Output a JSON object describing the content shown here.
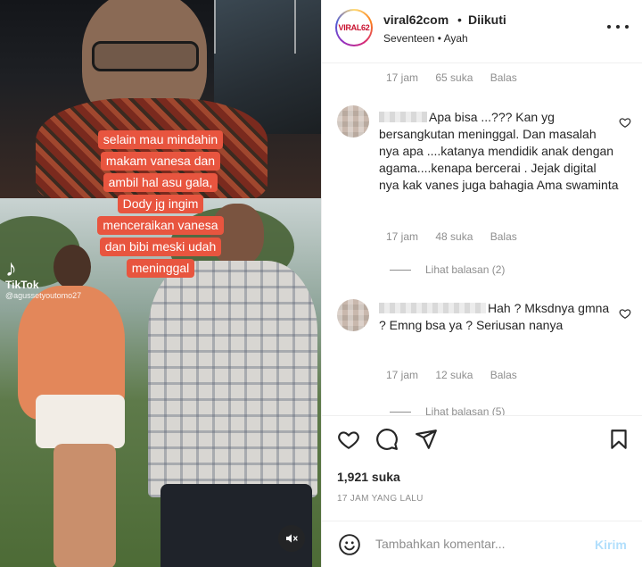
{
  "media": {
    "caption_lines": [
      "selain mau mindahin",
      "makam vanesa dan",
      "ambil hal asu gala,",
      "Dody jg ingim",
      "menceraikan vanesa",
      "dan bibi meski udah",
      "meninggal"
    ],
    "tiktok_name": "TikTok",
    "tiktok_handle": "@agussetyoutomo27",
    "mute_icon": "speaker-muted-icon"
  },
  "header": {
    "avatar_text": "VIRAL62",
    "username": "viral62com",
    "separator": "•",
    "follow_status": "Diikuti",
    "subtitle": "Seventeen • Ayah",
    "more_icon": "more-options-icon"
  },
  "comments": {
    "top_meta": {
      "time": "17 jam",
      "likes": "65 suka",
      "reply": "Balas"
    },
    "items": [
      {
        "text": "Apa bisa ...??? Kan yg bersangkutan meninggal. Dan masalah nya apa ....katanya mendidik anak dengan agama....kenapa bercerai . Jejak digital nya kak vanes juga bahagia Ama swaminta",
        "time": "17 jam",
        "likes": "48 suka",
        "reply": "Balas",
        "view_replies": "Lihat balasan (2)"
      },
      {
        "text": "Hah ? Mksdnya gmna ? Emng bsa ya ? Seriusan nanya",
        "time": "17 jam",
        "likes": "12 suka",
        "reply": "Balas",
        "view_replies": "Lihat balasan (5)"
      }
    ]
  },
  "actions": {
    "icons": [
      "heart-icon",
      "comment-icon",
      "share-icon",
      "bookmark-icon"
    ],
    "likes": "1,921 suka",
    "time_ago": "17 JAM YANG LALU"
  },
  "add_comment": {
    "placeholder": "Tambahkan komentar...",
    "post_label": "Kirim"
  },
  "colors": {
    "caption_bg": "#e8553f",
    "text_primary": "#262626",
    "text_secondary": "#8e8e8e",
    "post_disabled": "#b2dffc"
  }
}
